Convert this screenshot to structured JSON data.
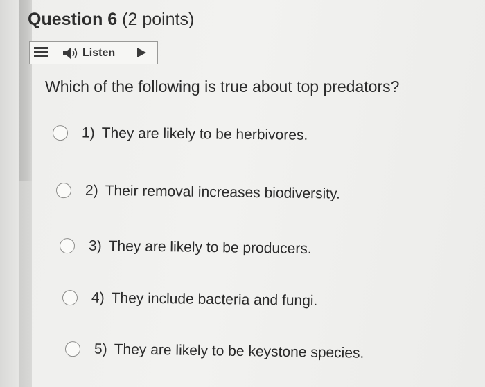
{
  "question": {
    "number_label": "Question 6",
    "points_label": "(2 points)",
    "text": "Which of the following is true about top predators?"
  },
  "toolbar": {
    "menu_icon": "menu-icon",
    "listen_icon": "speaker-icon",
    "listen_label": "Listen",
    "play_icon": "play-icon"
  },
  "options": [
    {
      "number": "1)",
      "text": "They are likely to be herbivores."
    },
    {
      "number": "2)",
      "text": "Their removal increases biodiversity."
    },
    {
      "number": "3)",
      "text": "They are likely to be producers."
    },
    {
      "number": "4)",
      "text": "They include bacteria and fungi."
    },
    {
      "number": "5)",
      "text": "They are likely to be keystone species."
    }
  ]
}
